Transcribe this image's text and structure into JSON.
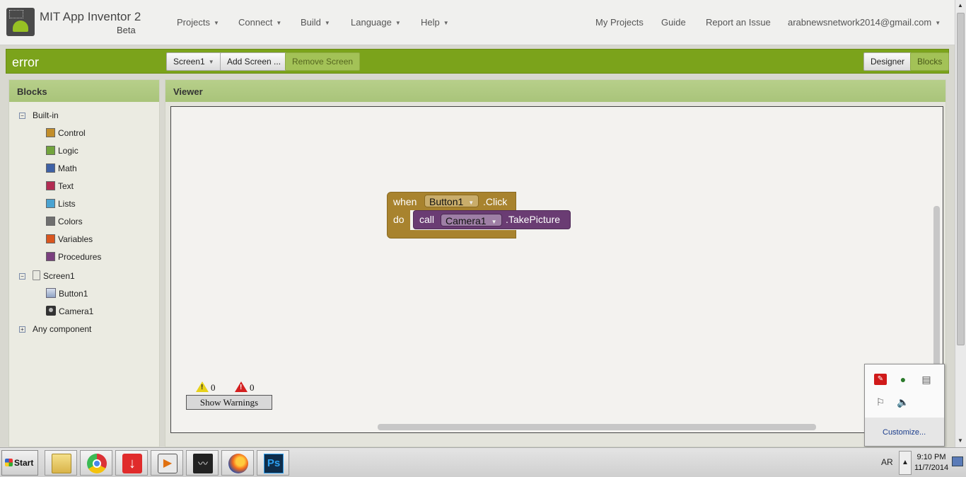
{
  "header": {
    "app_title": "MIT App Inventor 2",
    "beta_label": "Beta",
    "menus": [
      {
        "label": "Projects"
      },
      {
        "label": "Connect"
      },
      {
        "label": "Build"
      },
      {
        "label": "Language"
      },
      {
        "label": "Help"
      }
    ],
    "links": {
      "my_projects": "My Projects",
      "guide": "Guide",
      "report_issue": "Report an Issue",
      "account": "arabnewsnetwork2014@gmail.com"
    }
  },
  "toolbar": {
    "project_name": "error",
    "screen_select": "Screen1",
    "add_screen": "Add Screen ...",
    "remove_screen": "Remove Screen",
    "designer": "Designer",
    "blocks": "Blocks"
  },
  "blocks_panel": {
    "title": "Blocks",
    "builtin_label": "Built-in",
    "builtin_items": [
      {
        "label": "Control",
        "color": "#c28e2b"
      },
      {
        "label": "Logic",
        "color": "#72a43d"
      },
      {
        "label": "Math",
        "color": "#3e61a5"
      },
      {
        "label": "Text",
        "color": "#b22c52"
      },
      {
        "label": "Lists",
        "color": "#4aa3d1"
      },
      {
        "label": "Colors",
        "color": "#6f6f6f"
      },
      {
        "label": "Variables",
        "color": "#d9561f"
      },
      {
        "label": "Procedures",
        "color": "#7a3f7e"
      }
    ],
    "screen_label": "Screen1",
    "components": [
      {
        "label": "Button1",
        "icon": "button-icon"
      },
      {
        "label": "Camera1",
        "icon": "camera-icon"
      }
    ],
    "any_component": "Any component"
  },
  "viewer": {
    "title": "Viewer",
    "event_block": {
      "when": "when",
      "component": "Button1",
      "event": ".Click",
      "do": "do",
      "color": "#a8832e"
    },
    "call_block": {
      "call": "call",
      "component": "Camera1",
      "method": ".TakePicture",
      "color": "#6a3c73"
    },
    "warning_count": "0",
    "error_count": "0",
    "show_warnings": "Show Warnings"
  },
  "tray_popup": {
    "customize": "Customize..."
  },
  "taskbar": {
    "start": "Start",
    "apps": [
      "file-explorer-icon",
      "chrome-icon",
      "download-manager-icon",
      "media-player-icon",
      "audio-editor-icon",
      "firefox-icon",
      "photoshop-icon"
    ],
    "language": "AR",
    "time": "9:10 PM",
    "date": "11/7/2014"
  }
}
